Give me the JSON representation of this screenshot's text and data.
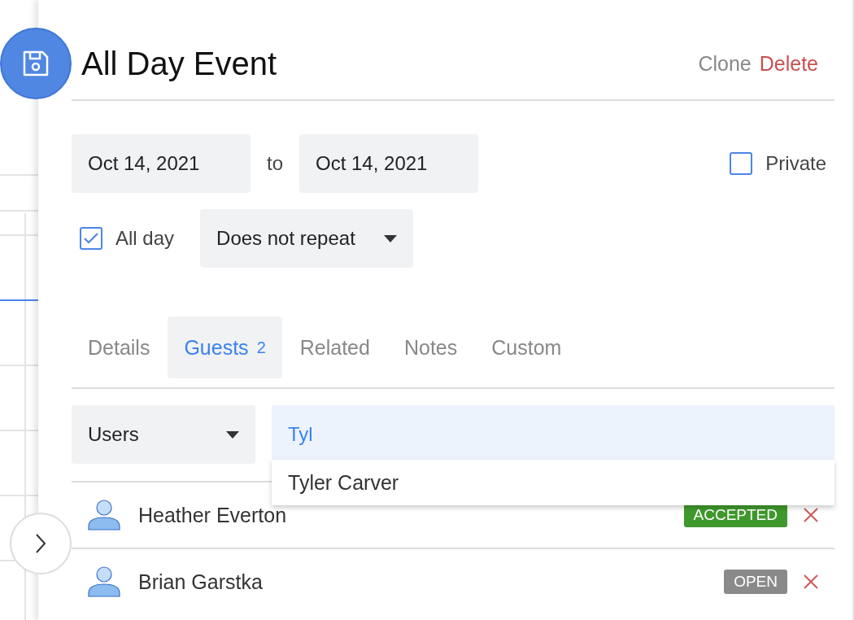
{
  "header": {
    "title": "All Day Event",
    "actions": [
      {
        "label": "Clone",
        "kind": "neutral"
      },
      {
        "label": "Delete",
        "kind": "danger"
      }
    ]
  },
  "dates": {
    "start": "Oct 14, 2021",
    "separator": "to",
    "end": "Oct 14, 2021"
  },
  "private": {
    "label": "Private",
    "checked": false
  },
  "all_day": {
    "label": "All day",
    "checked": true
  },
  "repeat": {
    "value": "Does not repeat"
  },
  "tabs": [
    {
      "label": "Details",
      "selected": false
    },
    {
      "label": "Guests",
      "count": "2",
      "selected": true
    },
    {
      "label": "Related",
      "selected": false
    },
    {
      "label": "Notes",
      "selected": false
    },
    {
      "label": "Custom",
      "selected": false
    }
  ],
  "guest_filter": {
    "type": "Users",
    "search": "Tyl",
    "suggestions": [
      "Tyler Carver"
    ]
  },
  "guests": [
    {
      "name": "Heather Everton",
      "status": "ACCEPTED",
      "color": "#3f982c"
    },
    {
      "name": "Brian Garstka",
      "status": "OPEN",
      "color": "#8a8a8a"
    }
  ]
}
